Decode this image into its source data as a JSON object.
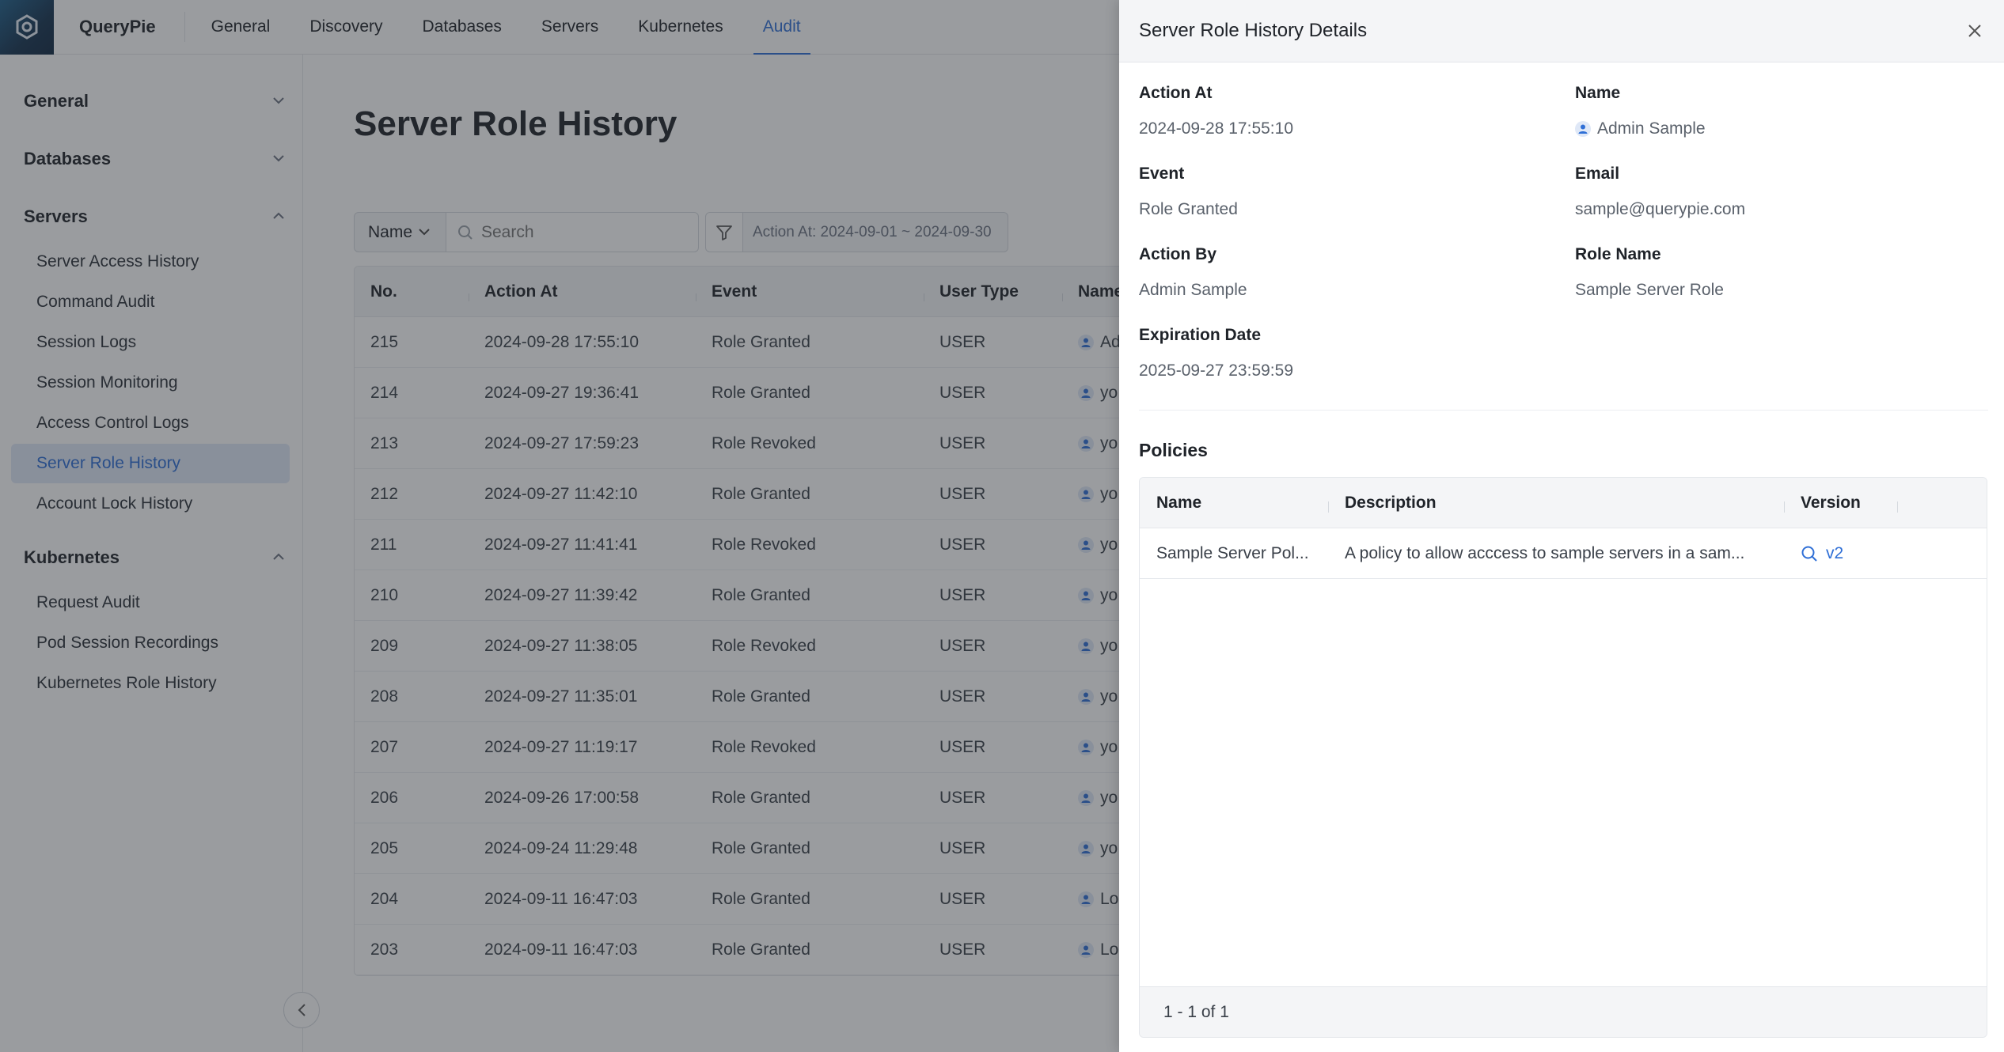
{
  "brand": "QueryPie",
  "nav": {
    "items": [
      {
        "label": "General"
      },
      {
        "label": "Discovery"
      },
      {
        "label": "Databases"
      },
      {
        "label": "Servers"
      },
      {
        "label": "Kubernetes"
      },
      {
        "label": "Audit",
        "active": true
      }
    ]
  },
  "sidebar": {
    "groups": [
      {
        "label": "General",
        "expanded": false
      },
      {
        "label": "Databases",
        "expanded": false
      },
      {
        "label": "Servers",
        "expanded": true,
        "items": [
          "Server Access History",
          "Command Audit",
          "Session Logs",
          "Session Monitoring",
          "Access Control Logs",
          "Server Role History",
          "Account Lock History"
        ],
        "active_item": "Server Role History"
      },
      {
        "label": "Kubernetes",
        "expanded": true,
        "items": [
          "Request Audit",
          "Pod Session Recordings",
          "Kubernetes Role History"
        ]
      }
    ]
  },
  "main": {
    "title": "Server Role History",
    "filter": {
      "select_label": "Name",
      "search_placeholder": "Search",
      "date_range": "Action At: 2024-09-01 ~ 2024-09-30"
    },
    "table": {
      "columns": [
        "No.",
        "Action At",
        "Event",
        "User Type",
        "Name"
      ],
      "rows": [
        {
          "no": "215",
          "at": "2024-09-28 17:55:10",
          "event": "Role Granted",
          "type": "USER",
          "name": "Ad"
        },
        {
          "no": "214",
          "at": "2024-09-27 19:36:41",
          "event": "Role Granted",
          "type": "USER",
          "name": "yo"
        },
        {
          "no": "213",
          "at": "2024-09-27 17:59:23",
          "event": "Role Revoked",
          "type": "USER",
          "name": "yo"
        },
        {
          "no": "212",
          "at": "2024-09-27 11:42:10",
          "event": "Role Granted",
          "type": "USER",
          "name": "yo"
        },
        {
          "no": "211",
          "at": "2024-09-27 11:41:41",
          "event": "Role Revoked",
          "type": "USER",
          "name": "yo"
        },
        {
          "no": "210",
          "at": "2024-09-27 11:39:42",
          "event": "Role Granted",
          "type": "USER",
          "name": "yo"
        },
        {
          "no": "209",
          "at": "2024-09-27 11:38:05",
          "event": "Role Revoked",
          "type": "USER",
          "name": "yo"
        },
        {
          "no": "208",
          "at": "2024-09-27 11:35:01",
          "event": "Role Granted",
          "type": "USER",
          "name": "yo"
        },
        {
          "no": "207",
          "at": "2024-09-27 11:19:17",
          "event": "Role Revoked",
          "type": "USER",
          "name": "yo"
        },
        {
          "no": "206",
          "at": "2024-09-26 17:00:58",
          "event": "Role Granted",
          "type": "USER",
          "name": "yo"
        },
        {
          "no": "205",
          "at": "2024-09-24 11:29:48",
          "event": "Role Granted",
          "type": "USER",
          "name": "yo"
        },
        {
          "no": "204",
          "at": "2024-09-11 16:47:03",
          "event": "Role Granted",
          "type": "USER",
          "name": "Lo"
        },
        {
          "no": "203",
          "at": "2024-09-11 16:47:03",
          "event": "Role Granted",
          "type": "USER",
          "name": "Lo"
        }
      ]
    }
  },
  "drawer": {
    "title": "Server Role History Details",
    "fields": {
      "action_at_label": "Action At",
      "action_at": "2024-09-28 17:55:10",
      "name_label": "Name",
      "name": "Admin Sample",
      "event_label": "Event",
      "event": "Role Granted",
      "email_label": "Email",
      "email": "sample@querypie.com",
      "action_by_label": "Action By",
      "action_by": "Admin Sample",
      "role_name_label": "Role Name",
      "role_name": "Sample Server Role",
      "expiration_label": "Expiration Date",
      "expiration": "2025-09-27 23:59:59"
    },
    "policies": {
      "title": "Policies",
      "columns": [
        "Name",
        "Description",
        "Version"
      ],
      "rows": [
        {
          "name": "Sample Server Pol...",
          "description": "A policy to allow acccess to sample servers in a sam...",
          "version": "v2"
        }
      ],
      "pagination": "1 - 1 of 1"
    }
  },
  "colors": {
    "accent": "#2f6fd6",
    "active_bg": "#dfe8f7",
    "overlay": "#282c34"
  }
}
